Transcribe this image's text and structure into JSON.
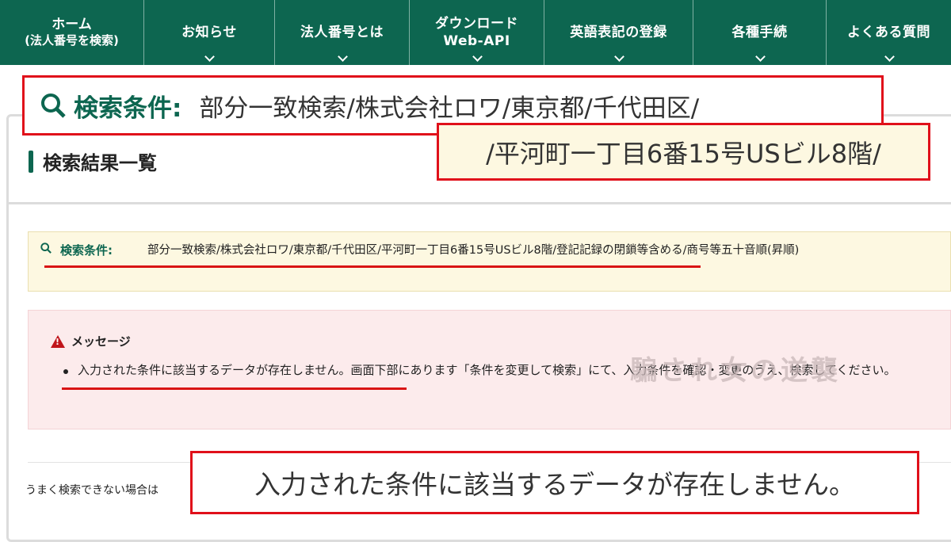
{
  "nav": {
    "items": [
      {
        "line1": "ホーム",
        "line2": "(法人番号を検索)"
      },
      {
        "label": "お知らせ"
      },
      {
        "label": "法人番号とは"
      },
      {
        "line1": "ダウンロード",
        "line2": "Web-API"
      },
      {
        "label": "英語表記の登録"
      },
      {
        "label": "各種手続"
      },
      {
        "label": "よくある質問"
      }
    ]
  },
  "section": {
    "title": "検索結果一覧"
  },
  "search_condition": {
    "label": "検索条件:",
    "text": "部分一致検索/株式会社ロワ/東京都/千代田区/平河町一丁目6番15号USビル8階/登記記録の閉鎖等含める/商号等五十音順(昇順)"
  },
  "message": {
    "title": "メッセージ",
    "text": "入力された条件に該当するデータが存在しません。画面下部にあります「条件を変更して検索」にて、入力条件を確認・変更のうえ、検索してください。"
  },
  "bottom": {
    "text": "うまく検索できない場合は"
  },
  "watermark": {
    "text": "騙され女の逆襲"
  },
  "callouts": {
    "condition_label": "検索条件:",
    "condition_line1": "部分一致検索/株式会社ロワ/東京都/千代田区/",
    "condition_line2": "/平河町一丁目6番15号USビル8階/",
    "message": "入力された条件に該当するデータが存在しません。"
  },
  "colors": {
    "brand": "#0d6650",
    "highlight": "#e0101a",
    "condition_bg": "#fdf8e1",
    "message_bg": "#fcebec"
  }
}
